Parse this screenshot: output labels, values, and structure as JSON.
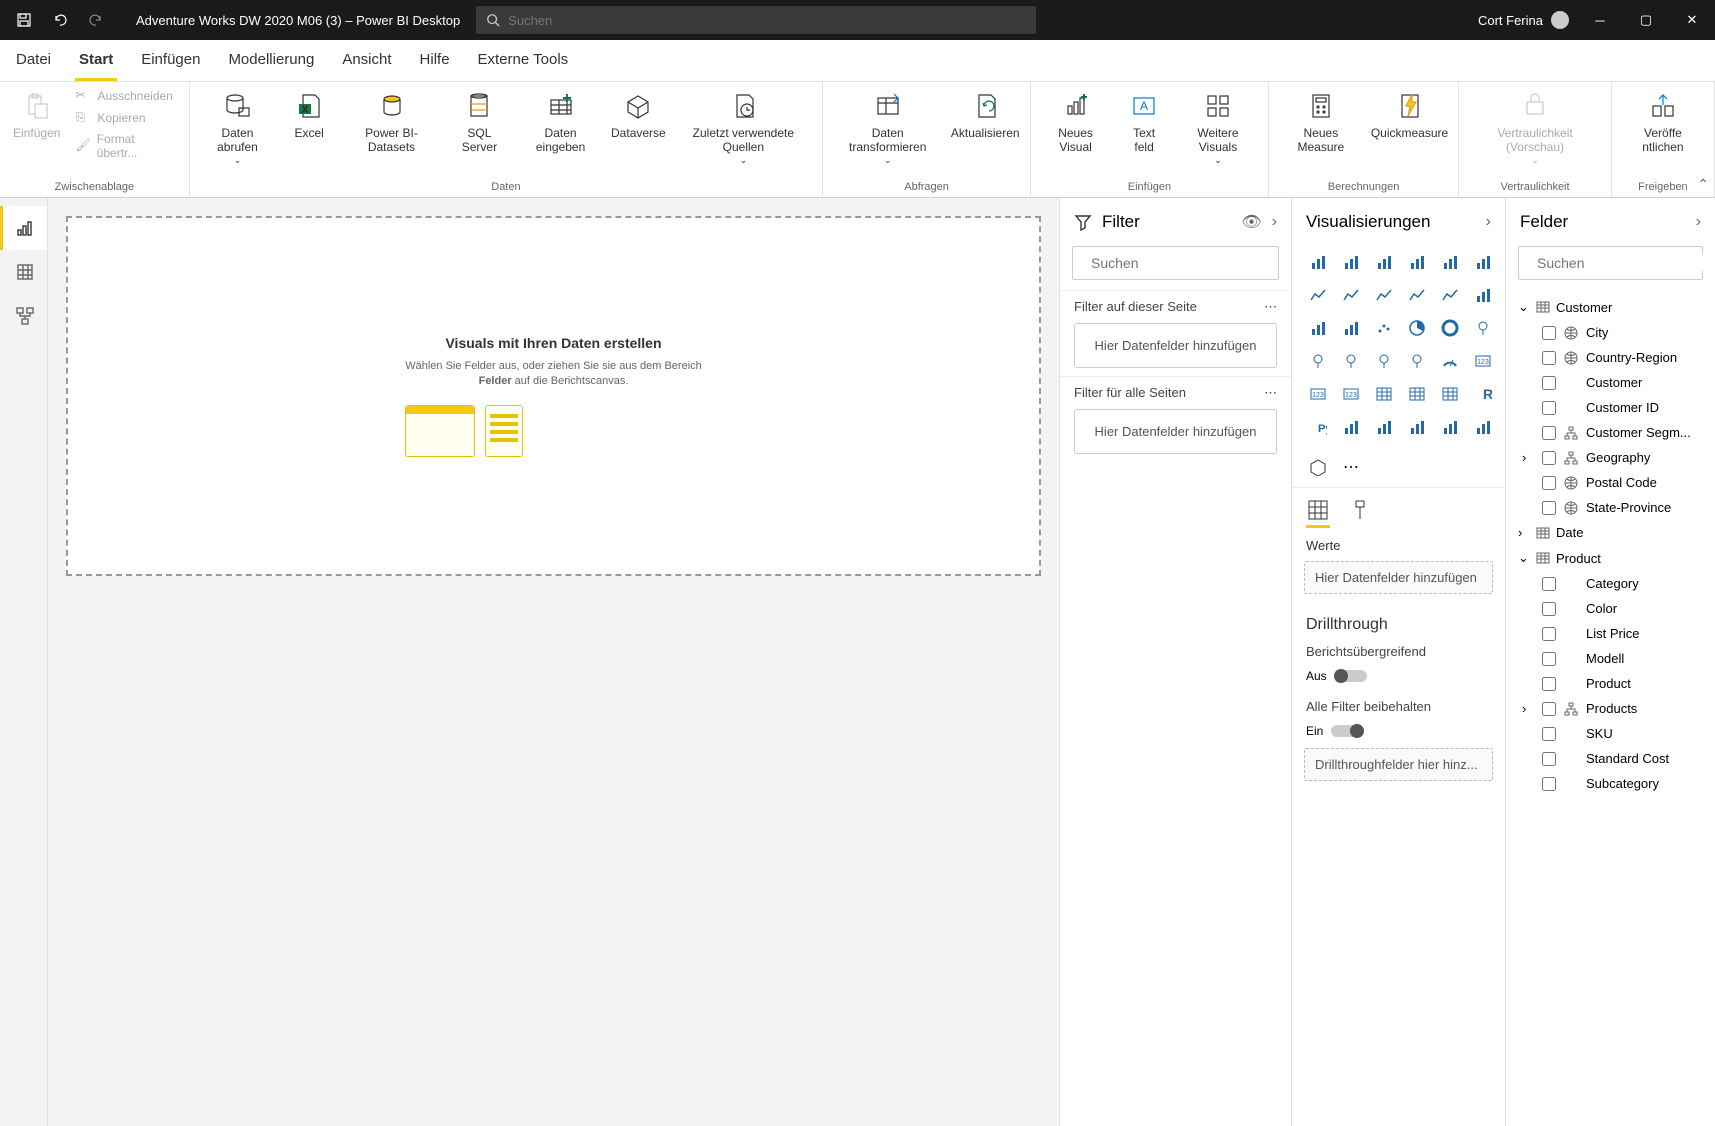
{
  "titlebar": {
    "title": "Adventure Works DW 2020 M06 (3) – Power BI Desktop",
    "search_placeholder": "Suchen",
    "user": "Cort Ferina"
  },
  "tabs": [
    "Datei",
    "Start",
    "Einfügen",
    "Modellierung",
    "Ansicht",
    "Hilfe",
    "Externe Tools"
  ],
  "active_tab": 1,
  "ribbon": {
    "clipboard": {
      "label": "Zwischenablage",
      "paste": "Einfügen",
      "cut": "Ausschneiden",
      "copy": "Kopieren",
      "format_painter": "Format übertr..."
    },
    "data": {
      "label": "Daten",
      "get_data": "Daten abrufen",
      "excel": "Excel",
      "pbi_datasets": "Power BI-Datasets",
      "sql": "SQL Server",
      "enter": "Daten eingeben",
      "dataverse": "Dataverse",
      "recent": "Zuletzt verwendete Quellen"
    },
    "queries": {
      "label": "Abfragen",
      "transform": "Daten transformieren",
      "refresh": "Aktualisieren"
    },
    "insert": {
      "label": "Einfügen",
      "visual": "Neues Visual",
      "textbox": "Text feld",
      "more": "Weitere Visuals"
    },
    "calc": {
      "label": "Berechnungen",
      "measure": "Neues Measure",
      "quick": "Quickmeasure"
    },
    "sensitivity": {
      "label": "Vertraulichkeit",
      "btn": "Vertraulichkeit (Vorschau)"
    },
    "share": {
      "label": "Freigeben",
      "publish": "Veröffe ntlichen"
    }
  },
  "canvas": {
    "title": "Visuals mit Ihren Daten erstellen",
    "line1": "Wählen Sie Felder aus, oder ziehen Sie sie aus dem Bereich",
    "line2_bold": "Felder",
    "line2_rest": " auf die Berichtscanvas."
  },
  "filter": {
    "title": "Filter",
    "search_placeholder": "Suchen",
    "this_page": "Filter auf dieser Seite",
    "all_pages": "Filter für alle Seiten",
    "add_here": "Hier Datenfelder hinzufügen"
  },
  "viz": {
    "title": "Visualisierungen",
    "values": "Werte",
    "add_here": "Hier Datenfelder hinzufügen",
    "drillthrough": "Drillthrough",
    "cross_report": "Berichtsübergreifend",
    "off": "Aus",
    "keep_filters": "Alle Filter beibehalten",
    "on": "Ein",
    "drill_add": "Drillthroughfelder hier hinz..."
  },
  "fields": {
    "title": "Felder",
    "search_placeholder": "Suchen",
    "tables": [
      {
        "name": "Customer",
        "expanded": true,
        "fields": [
          {
            "name": "City",
            "icon": "globe"
          },
          {
            "name": "Country-Region",
            "icon": "globe"
          },
          {
            "name": "Customer",
            "icon": ""
          },
          {
            "name": "Customer ID",
            "icon": ""
          },
          {
            "name": "Customer Segm...",
            "icon": "hier"
          },
          {
            "name": "Geography",
            "icon": "hier",
            "chevron": true
          },
          {
            "name": "Postal Code",
            "icon": "globe"
          },
          {
            "name": "State-Province",
            "icon": "globe"
          }
        ]
      },
      {
        "name": "Date",
        "expanded": false,
        "fields": []
      },
      {
        "name": "Product",
        "expanded": true,
        "fields": [
          {
            "name": "Category",
            "icon": ""
          },
          {
            "name": "Color",
            "icon": ""
          },
          {
            "name": "List Price",
            "icon": ""
          },
          {
            "name": "Modell",
            "icon": ""
          },
          {
            "name": "Product",
            "icon": ""
          },
          {
            "name": "Products",
            "icon": "hier",
            "chevron": true
          },
          {
            "name": "SKU",
            "icon": ""
          },
          {
            "name": "Standard Cost",
            "icon": ""
          },
          {
            "name": "Subcategory",
            "icon": ""
          }
        ]
      }
    ]
  }
}
